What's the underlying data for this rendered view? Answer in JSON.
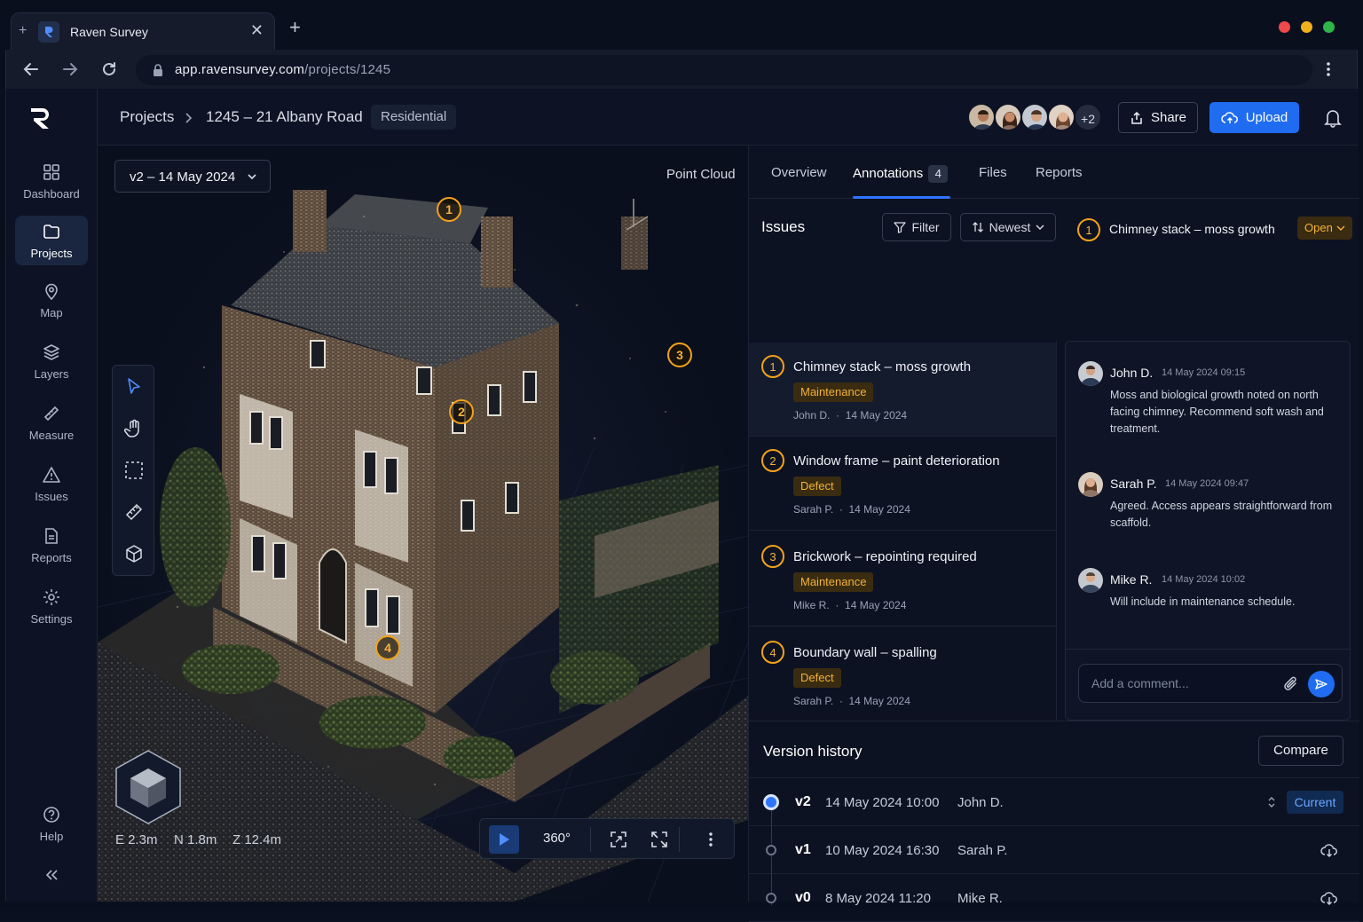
{
  "browser": {
    "tab_title": "Raven Survey",
    "url_host": "app.ravensurvey.com",
    "url_path": "/projects/1245"
  },
  "sidebar": {
    "items": [
      {
        "label": "Dashboard",
        "icon": "grid-icon"
      },
      {
        "label": "Projects",
        "icon": "folder-icon"
      },
      {
        "label": "Map",
        "icon": "map-pin-icon"
      },
      {
        "label": "Layers",
        "icon": "layers-icon"
      },
      {
        "label": "Measure",
        "icon": "ruler-icon"
      },
      {
        "label": "Issues",
        "icon": "warning-icon"
      },
      {
        "label": "Reports",
        "icon": "document-icon"
      },
      {
        "label": "Settings",
        "icon": "gear-icon"
      }
    ],
    "help_label": "Help"
  },
  "header": {
    "breadcrumb_projects": "Projects",
    "breadcrumb_project": "1245 – 21 Albany Road",
    "project_tag": "Residential",
    "extra_members": "+2",
    "share_label": "Share",
    "upload_label": "Upload"
  },
  "viewer": {
    "version_select": "v2 – 14 May 2024",
    "mode_label": "Point Cloud",
    "coord_e": "E 2.3m",
    "coord_n": "N 1.8m",
    "coord_z": "Z 12.4m",
    "rotation_label": "360°",
    "markers": [
      "1",
      "2",
      "3",
      "4"
    ]
  },
  "panel": {
    "tabs": [
      "Overview",
      "Annotations",
      "Files",
      "Reports"
    ],
    "annotations_count": "4",
    "issues_title": "Issues",
    "filter_label": "Filter",
    "sort_label": "Newest",
    "issues": [
      {
        "num": "1",
        "title": "Chimney stack – moss growth",
        "tag": "Maintenance",
        "author": "John D.",
        "date": "14 May 2024"
      },
      {
        "num": "2",
        "title": "Window frame – paint deterioration",
        "tag": "Defect",
        "author": "Sarah P.",
        "date": "14 May 2024"
      },
      {
        "num": "3",
        "title": "Brickwork – repointing required",
        "tag": "Maintenance",
        "author": "Mike R.",
        "date": "14 May 2024"
      },
      {
        "num": "4",
        "title": "Boundary wall – spalling",
        "tag": "Defect",
        "author": "Sarah P.",
        "date": "14 May 2024"
      }
    ],
    "thread": {
      "num": "1",
      "title": "Chimney stack – moss growth",
      "status": "Open",
      "comments": [
        {
          "name": "John D.",
          "time": "14 May 2024 09:15",
          "text": "Moss and biological growth noted on north facing chimney. Recommend soft wash and treatment."
        },
        {
          "name": "Sarah P.",
          "time": "14 May 2024 09:47",
          "text": "Agreed. Access appears straightforward from scaffold."
        },
        {
          "name": "Mike R.",
          "time": "14 May 2024 10:02",
          "text": "Will include in maintenance schedule."
        }
      ],
      "input_placeholder": "Add a comment..."
    },
    "version_history": {
      "title": "Version history",
      "compare_label": "Compare",
      "versions": [
        {
          "name": "v2",
          "date": "14 May 2024 10:00",
          "user": "John D.",
          "badge": "Current"
        },
        {
          "name": "v1",
          "date": "10 May 2024 16:30",
          "user": "Sarah P."
        },
        {
          "name": "v0",
          "date": "8 May 2024 11:20",
          "user": "Mike R."
        }
      ]
    }
  },
  "colors": {
    "accent": "#1f6cf0",
    "marker": "#f1a21b",
    "background": "#0d1222"
  }
}
